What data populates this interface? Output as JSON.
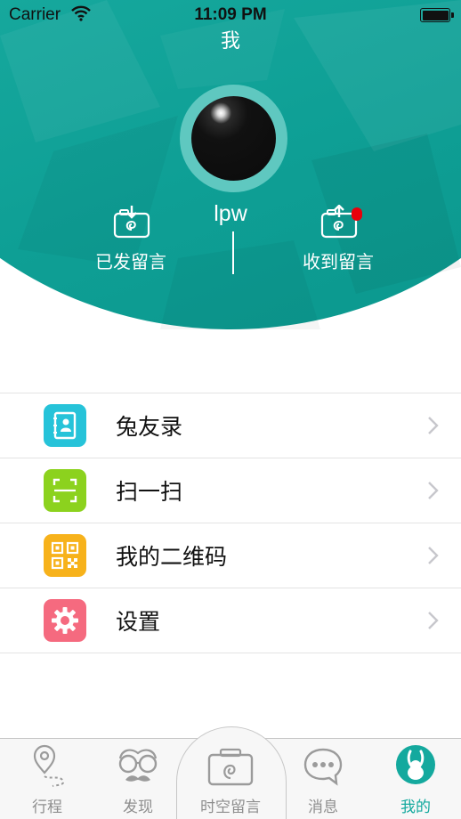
{
  "status_bar": {
    "carrier": "Carrier",
    "time": "11:09 PM"
  },
  "header": {
    "title": "我",
    "username": "lpw",
    "sent_label": "已发留言",
    "received_label": "收到留言",
    "accent_color": "#14a99e",
    "badge_color": "#e8000b"
  },
  "menu": {
    "items": [
      {
        "label": "兔友录",
        "icon": "contacts-book-icon",
        "color": "#26c3d9"
      },
      {
        "label": "扫一扫",
        "icon": "scan-icon",
        "color": "#8cd21e"
      },
      {
        "label": "我的二维码",
        "icon": "qr-code-icon",
        "color": "#f7b21b"
      },
      {
        "label": "设置",
        "icon": "gear-icon",
        "color": "#f56a7f"
      }
    ]
  },
  "tabbar": {
    "tabs": [
      {
        "label": "行程",
        "icon": "map-pin-route-icon",
        "active": false
      },
      {
        "label": "发现",
        "icon": "glasses-mustache-icon",
        "active": false
      },
      {
        "label": "时空留言",
        "icon": "camera-swirl-icon",
        "active": false
      },
      {
        "label": "消息",
        "icon": "chat-bubble-icon",
        "active": false
      },
      {
        "label": "我的",
        "icon": "rabbit-icon",
        "active": true
      }
    ]
  }
}
